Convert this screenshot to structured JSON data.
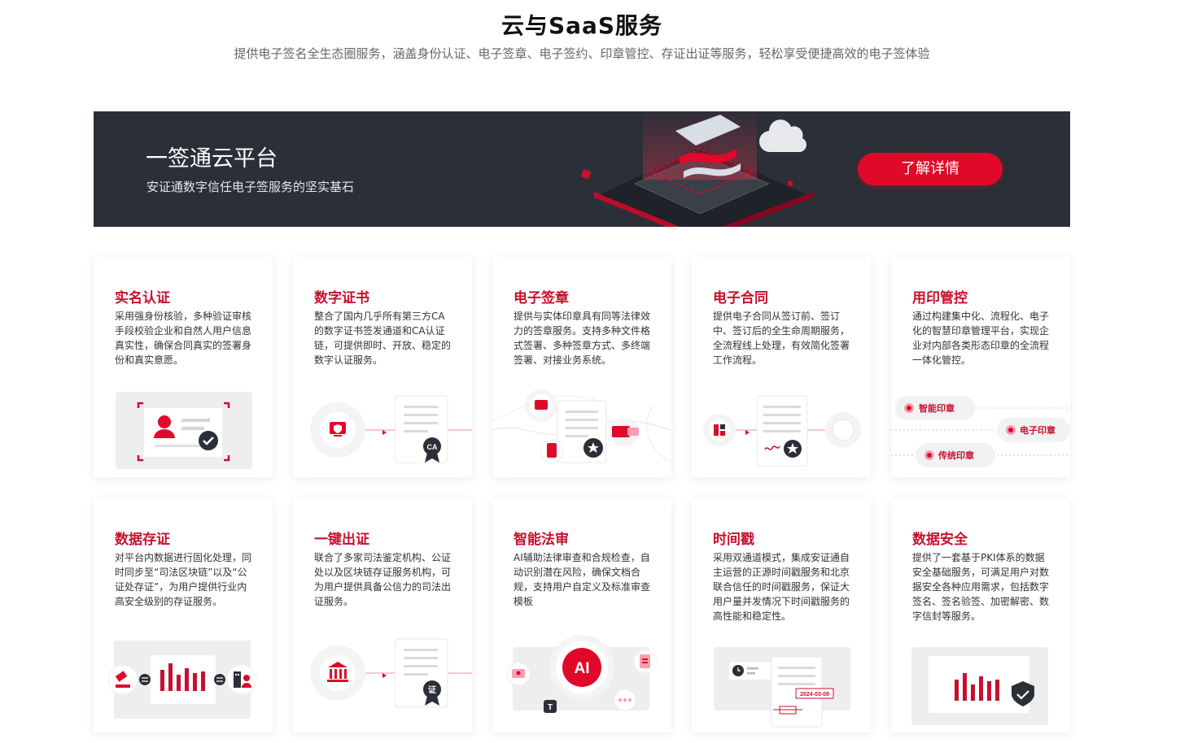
{
  "header": {
    "title": "云与SaaS服务",
    "subtitle": "提供电子签名全生态圈服务，涵盖身份认证、电子签章、电子签约、印章管控、存证出证等服务，轻松享受便捷高效的电子签体验"
  },
  "banner": {
    "title": "一签通云平台",
    "subtitle": "安证通数字信任电子签服务的坚实基石",
    "button_label": "了解详情"
  },
  "colors": {
    "accent": "#c8102e",
    "button": "#e0092a",
    "banner_bg": "#2b2f37"
  },
  "cards": [
    {
      "title": "实名认证",
      "desc": "采用强身份核验，多种验证审核手段校验企业和自然人用户信息真实性，确保合同真实的签署身份和真实意愿。",
      "icon": "id-card-icon"
    },
    {
      "title": "数字证书",
      "desc": "整合了国内几乎所有第三方CA的数字证书签发通道和CA认证链，可提供即时、开放、稳定的数字认证服务。",
      "icon": "certificate-icon",
      "badge": "CA"
    },
    {
      "title": "电子签章",
      "desc": "提供与实体印章具有同等法律效力的签章服务。支持多种文件格式签署、多种签章方式、多终端签署、对接业务系统。",
      "icon": "seal-icon"
    },
    {
      "title": "电子合同",
      "desc": "提供电子合同从签订前、签订中、签订后的全生命周期服务，全流程线上处理，有效简化签署工作流程。",
      "icon": "contract-icon"
    },
    {
      "title": "用印管控",
      "desc": "通过构建集中化、流程化、电子化的智慧印章管理平台，实现企业对内部各类形态印章的全流程一体化管控。",
      "icon": "seal-control-icon",
      "tags": [
        "智能印章",
        "电子印章",
        "传统印章"
      ]
    },
    {
      "title": "数据存证",
      "desc": "对平台内数据进行固化处理，同时同步至“司法区块链”以及“公证处存证”，为用户提供行业内高安全级别的存证服务。",
      "icon": "data-storage-icon"
    },
    {
      "title": "一键出证",
      "desc": "联合了多家司法鉴定机构、公证处以及区块链存证服务机构，可为用户提供具备公信力的司法出证服务。",
      "icon": "court-icon",
      "badge": "证"
    },
    {
      "title": "智能法审",
      "desc": "AI辅助法律审查和合规检查，自动识别潜在风险，确保文档合规，支持用户自定义及标准审查模板",
      "icon": "ai-icon",
      "badge": "AI",
      "badge2": "T"
    },
    {
      "title": "时间戳",
      "desc": "采用双通道模式，集成安证通自主运营的正源时间戳服务和北京联合信任的时间戳服务，保证大用户量并发情况下时间戳服务的高性能和稳定性。",
      "icon": "timestamp-icon",
      "date": "2024-03-09"
    },
    {
      "title": "数据安全",
      "desc": "提供了一套基于PKI体系的数据安全基础服务，可满足用户对数据安全各种应用需求，包括数字签名、签名验签、加密解密、数字信封等服务。",
      "icon": "shield-icon"
    }
  ]
}
